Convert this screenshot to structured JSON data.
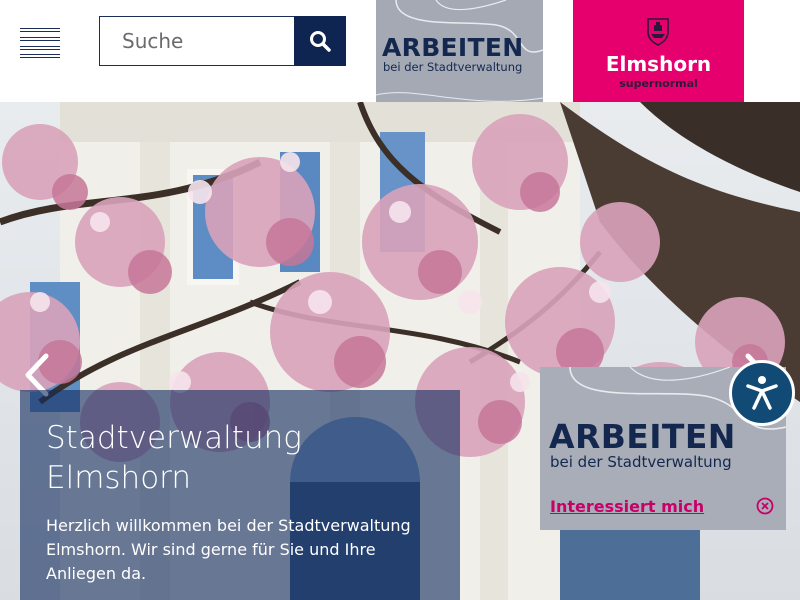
{
  "header": {
    "menu_icon": "hamburger-menu-icon",
    "search": {
      "placeholder": "Suche",
      "value": "",
      "icon": "search-icon"
    },
    "arbeiten_tile": {
      "title": "ARBEITEN",
      "subtitle": "bei der Stadtverwaltung"
    },
    "elmshorn_tile": {
      "name": "Elmshorn",
      "tagline": "supernormal",
      "icon": "city-crest-icon"
    }
  },
  "hero": {
    "title": "Stadtverwaltung Elmshorn",
    "text": "Herzlich willkommen bei der Stadtverwaltung Elmshorn. Wir sind gerne für Sie und Ihre Anliegen da.",
    "prev_icon": "chevron-left-icon",
    "next_icon": "chevron-right-icon"
  },
  "popup": {
    "title": "ARBEITEN",
    "subtitle": "bei der Stadtverwaltung",
    "link": "Interessiert mich",
    "close_icon": "close-circle-icon"
  },
  "accessibility": {
    "icon": "accessibility-icon"
  },
  "colors": {
    "navy": "#1b2d5a",
    "search_button": "#0d2550",
    "tile_grey": "#a4a9b4",
    "elmshorn_pink": "#e6006e",
    "link_pink": "#c8006a",
    "accessibility_blue": "#114a74"
  }
}
